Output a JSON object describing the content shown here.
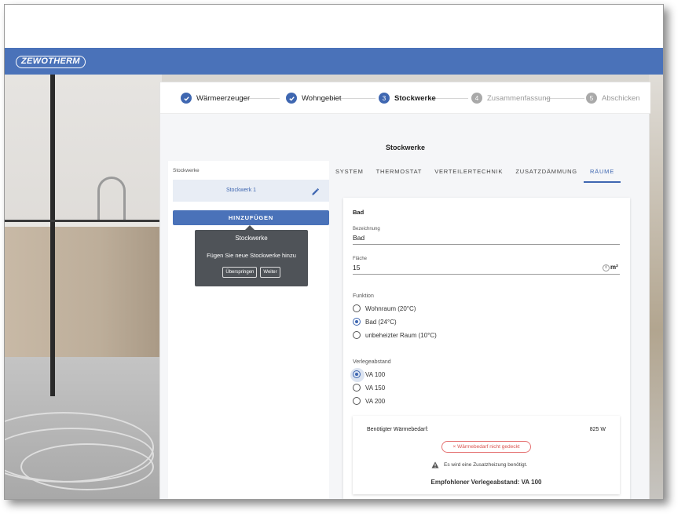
{
  "app": {
    "logo": "ZEWOTHERM",
    "brand_color": "#4a72b9"
  },
  "stepper": {
    "steps": [
      {
        "label": "Wärmeerzeuger",
        "state": "done"
      },
      {
        "label": "Wohngebiet",
        "state": "done"
      },
      {
        "label": "Stockwerke",
        "state": "active",
        "number": "3"
      },
      {
        "label": "Zusammenfassung",
        "state": "inactive",
        "number": "4"
      },
      {
        "label": "Abschicken",
        "state": "inactive",
        "number": "5"
      }
    ]
  },
  "section_title": "Stockwerke",
  "left": {
    "heading": "Stockwerke",
    "items": [
      {
        "label": "Stockwerk 1"
      }
    ],
    "add_button": "HINZUFÜGEN",
    "tooltip": {
      "title": "Stockwerke",
      "text": "Fügen Sie neue Stockwerke hinzu",
      "skip": "Überspringen",
      "next": "Weiter"
    }
  },
  "tabs": [
    {
      "label": "SYSTEM",
      "active": false
    },
    {
      "label": "THERMOSTAT",
      "active": false
    },
    {
      "label": "VERTEILERTECHNIK",
      "active": false
    },
    {
      "label": "ZUSATZDÄMMUNG",
      "active": false
    },
    {
      "label": "RÄUME",
      "active": true
    }
  ],
  "room": {
    "title": "Bad",
    "name_label": "Bezeichnung",
    "name_value": "Bad",
    "area_label": "Fläche",
    "area_value": "15",
    "area_unit": "m²",
    "function_label": "Funktion",
    "function_options": [
      "Wohnraum (20°C)",
      "Bad (24°C)",
      "unbeheizter Raum (10°C)"
    ],
    "function_selected": "Bad (24°C)",
    "spacing_label": "Verlegeabstand",
    "spacing_options": [
      "VA 100",
      "VA 150",
      "VA 200"
    ],
    "spacing_selected": "VA 100"
  },
  "result": {
    "demand_label": "Benötigter Wärmebedarf:",
    "demand_value": "825 W",
    "chip": "Wärmebedarf nicht gedeckt",
    "warning": "Es wird eine Zusatzheizung benötigt.",
    "recommendation": "Empfohlener Verlegeabstand: VA 100"
  }
}
